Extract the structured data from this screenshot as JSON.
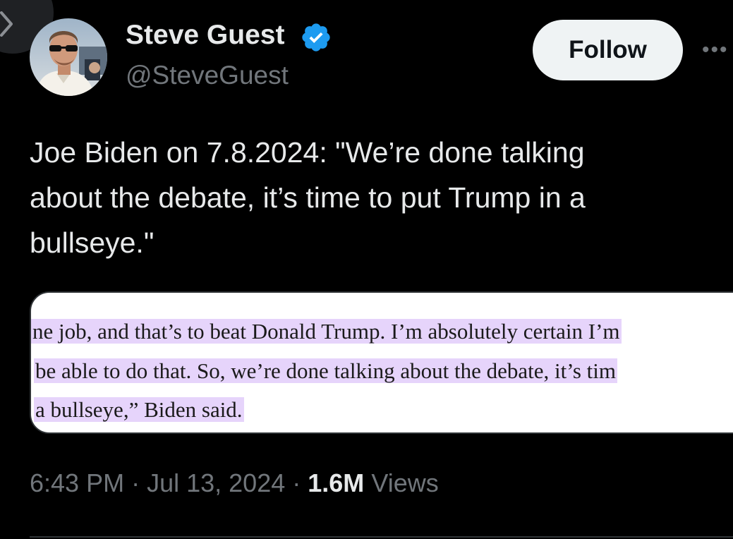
{
  "author": {
    "display_name": "Steve Guest",
    "handle": "@SteveGuest",
    "verified": true
  },
  "follow_button": {
    "label": "Follow"
  },
  "more_button": {
    "label": "•••"
  },
  "tweet": {
    "text": "Joe Biden on 7.8.2024: \"We’re done talking\nabout the debate, it’s time to put Trump in a\nbullseye.\""
  },
  "media": {
    "excerpt_lines": [
      "ne job, and that’s to beat Donald Trump. I’m absolutely certain I’m",
      "be able to do that. So, we’re done talking about the debate, it’s tim",
      "a bullseye,” Biden said."
    ]
  },
  "meta": {
    "time": "6:43 PM",
    "date": "Jul 13, 2024",
    "views_count": "1.6M",
    "views_label": "Views"
  },
  "colors": {
    "background": "#000000",
    "text": "#e7e9ea",
    "secondary_text": "#71767b",
    "verified_badge": "#1d9bf0",
    "follow_button_bg": "#eff3f4",
    "highlight": "#e6d4fb"
  },
  "icons": {
    "verified": "verified-badge-icon",
    "more": "more-horizontal-icon",
    "back": "back-arrow-icon"
  }
}
